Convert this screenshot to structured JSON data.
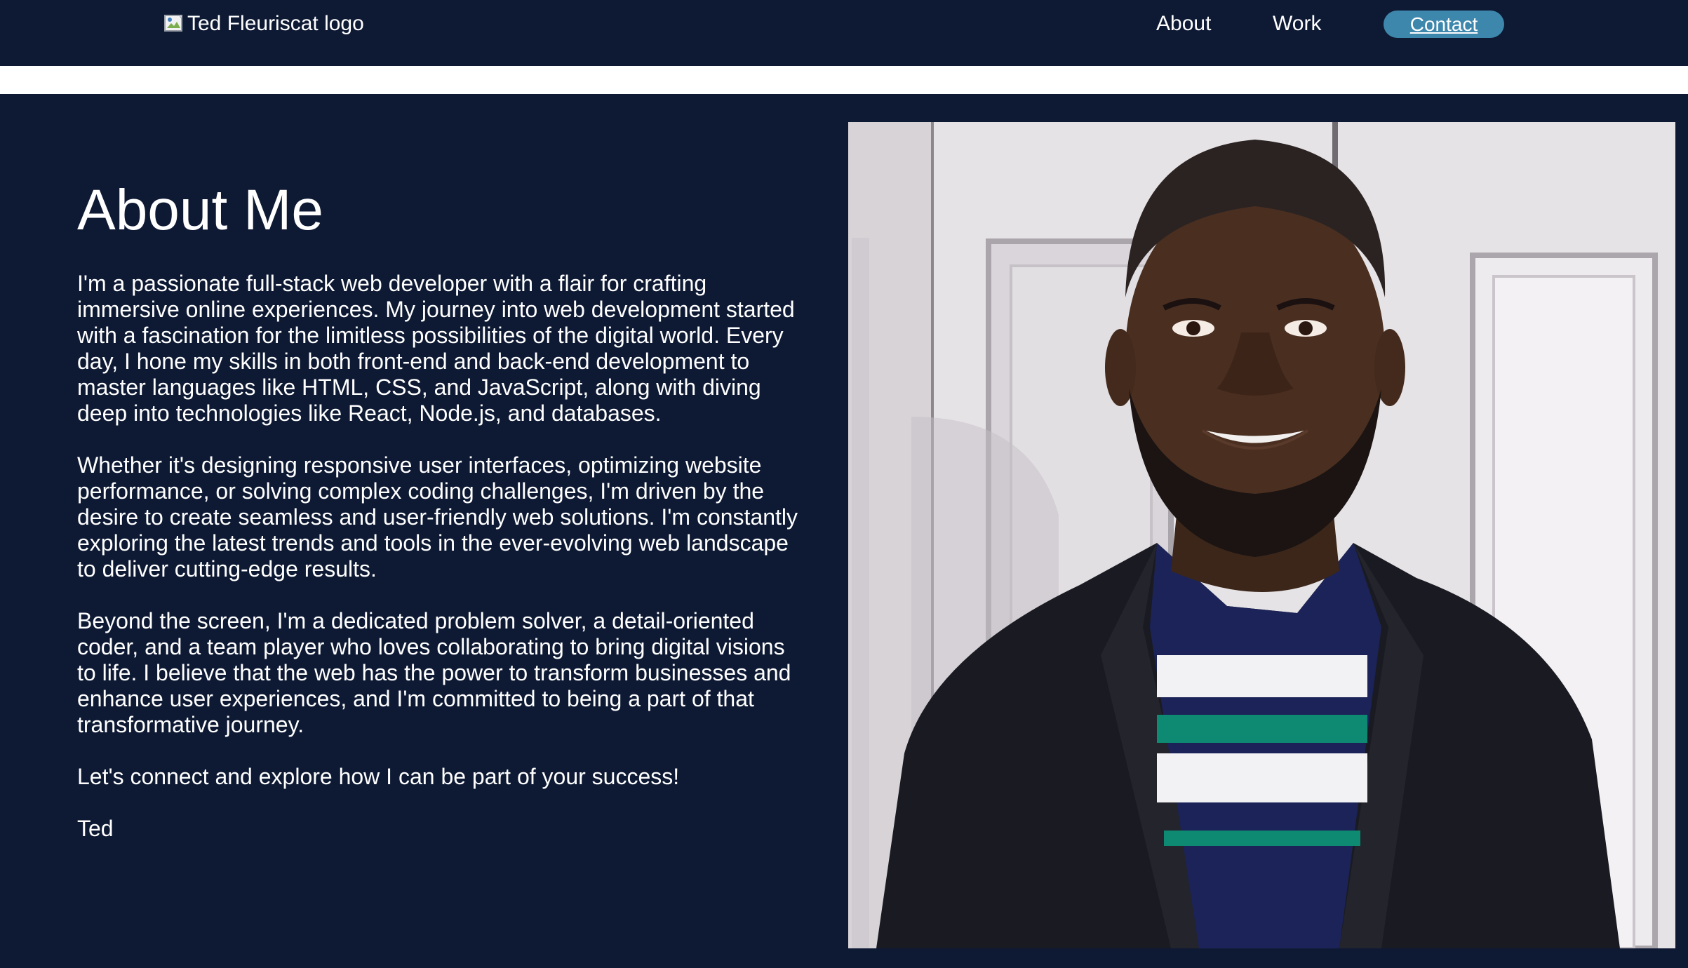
{
  "header": {
    "logo_alt": "Ted Fleuriscat logo",
    "nav": {
      "about": "About",
      "work": "Work",
      "contact": "Contact"
    }
  },
  "about": {
    "title": "About Me",
    "paragraphs": [
      "I'm a passionate full-stack web developer with a flair for crafting immersive online experiences. My journey into web development started with a fascination for the limitless possibilities of the digital world. Every day, I hone my skills in both front-end and back-end development to master languages like HTML, CSS, and JavaScript, along with diving deep into technologies like React, Node.js, and databases.",
      "Whether it's designing responsive user interfaces, optimizing website performance, or solving complex coding challenges, I'm driven by the desire to create seamless and user-friendly web solutions. I'm constantly exploring the latest trends and tools in the ever-evolving web landscape to deliver cutting-edge results.",
      "Beyond the screen, I'm a dedicated problem solver, a detail-oriented coder, and a team player who loves collaborating to bring digital visions to life. I believe that the web has the power to transform businesses and enhance user experiences, and I'm committed to being a part of that transformative journey.",
      "Let's connect and explore how I can be part of your success!",
      "Ted"
    ]
  },
  "colors": {
    "background": "#0e1a34",
    "accent": "#3d87ad",
    "text": "#ffffff"
  }
}
